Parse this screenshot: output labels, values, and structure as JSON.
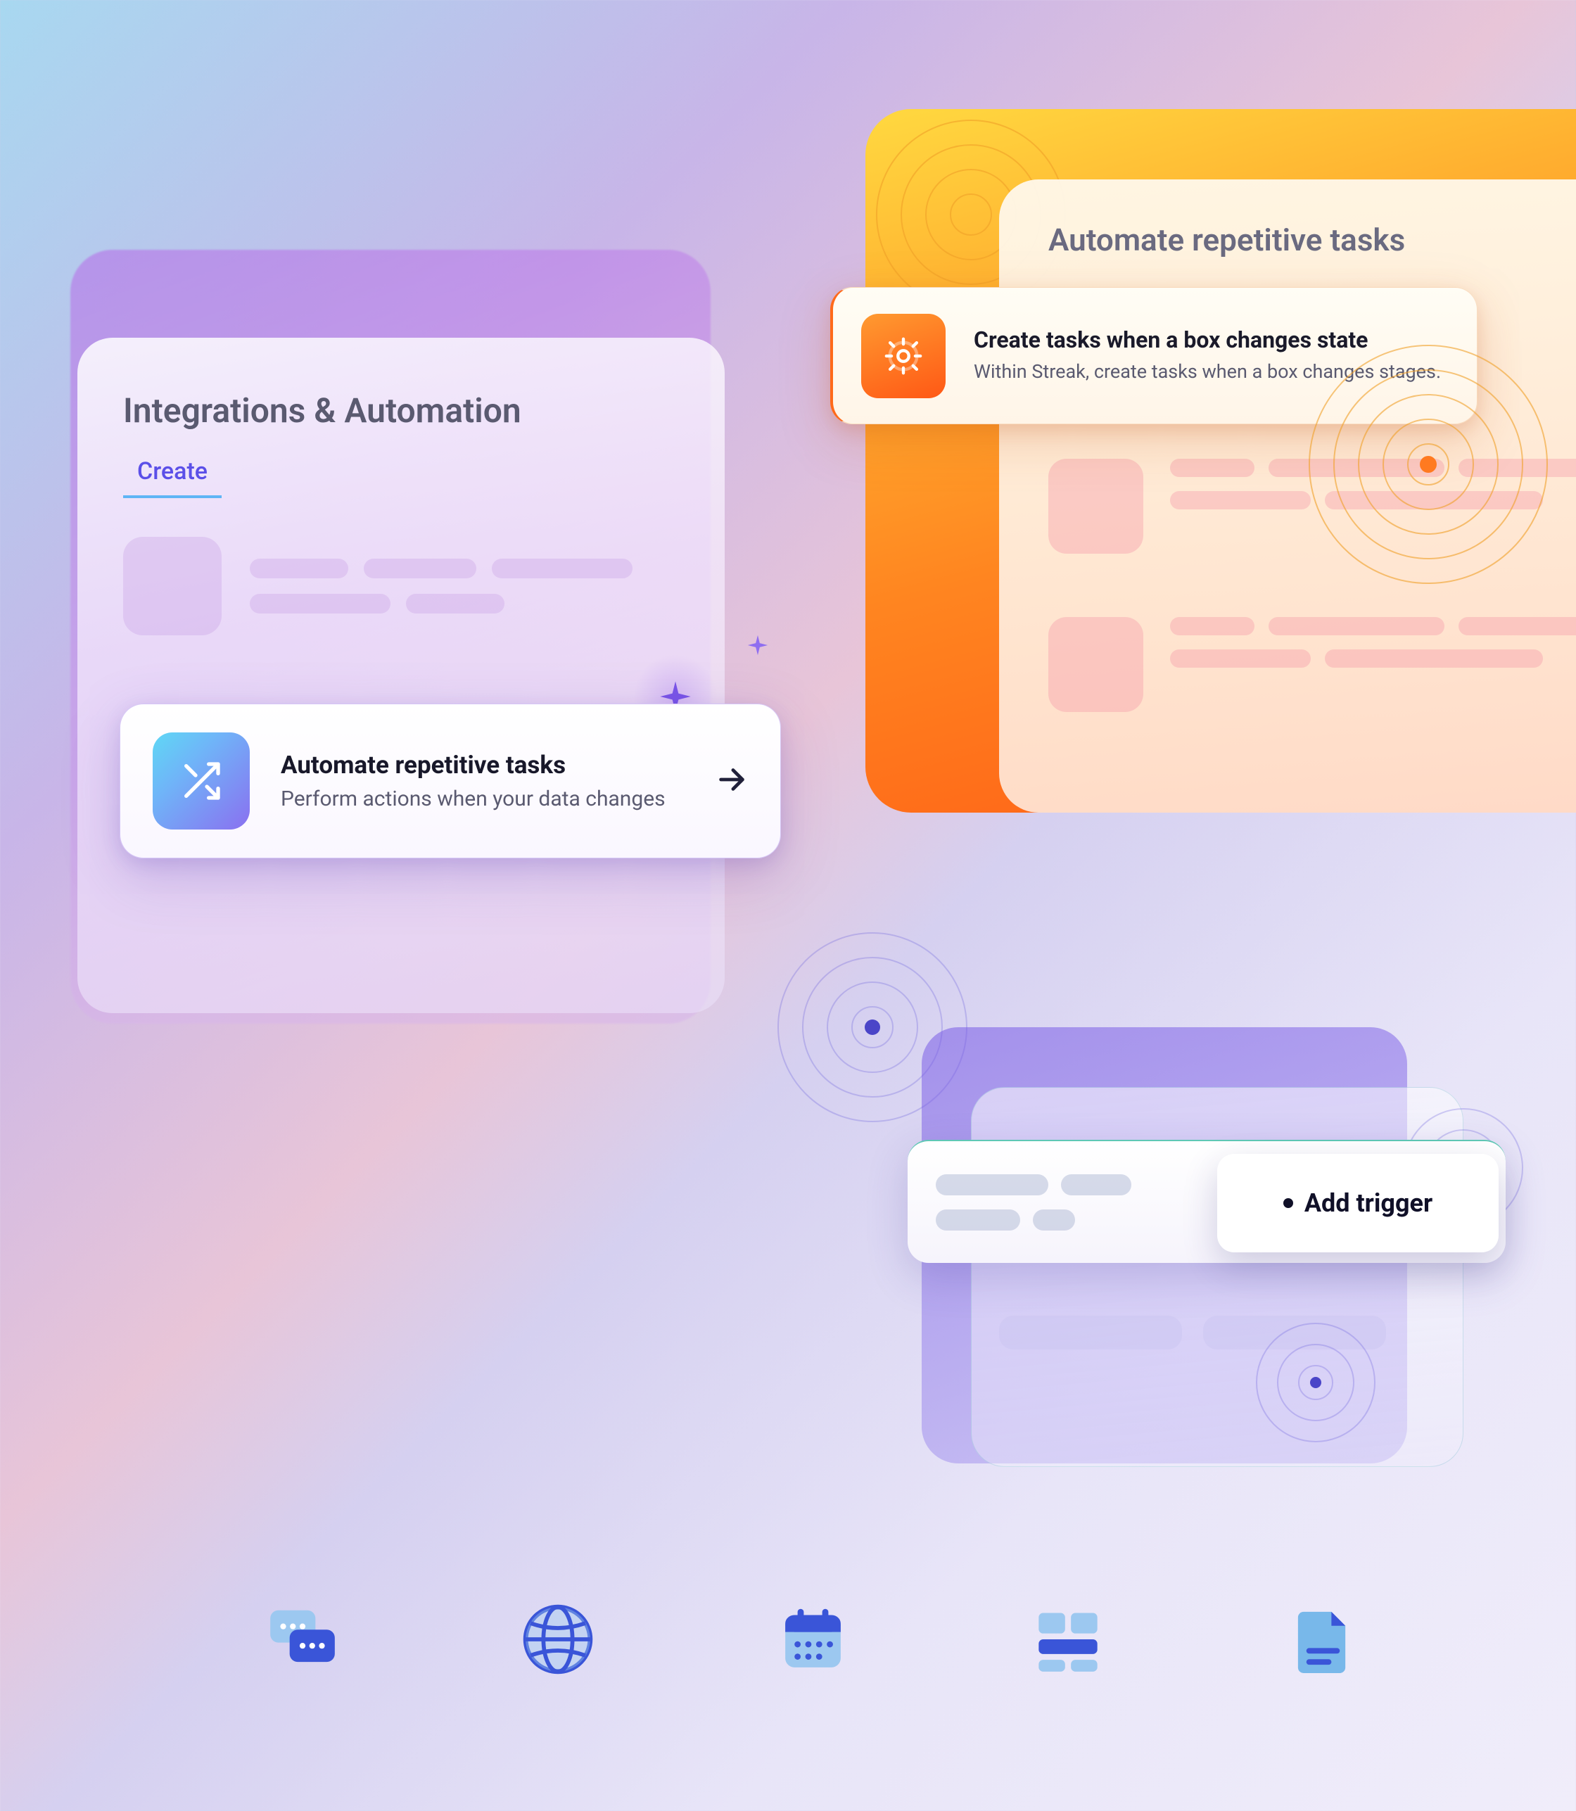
{
  "panel_integrations": {
    "title": "Integrations & Automation",
    "tabs": {
      "create": "Create"
    }
  },
  "card_automate": {
    "title": "Automate repetitive tasks",
    "subtitle": "Perform actions when your data changes"
  },
  "panel_orange": {
    "title": "Automate repetitive tasks"
  },
  "card_orange": {
    "title": "Create tasks when a box changes state",
    "subtitle": "Within Streak, create tasks when a box changes stages."
  },
  "trigger": {
    "button_label": "Add trigger"
  },
  "icons": {
    "chat": "chat-icon",
    "globe": "globe-icon",
    "calendar": "calendar-icon",
    "grid": "grid-icon",
    "document": "document-icon"
  }
}
